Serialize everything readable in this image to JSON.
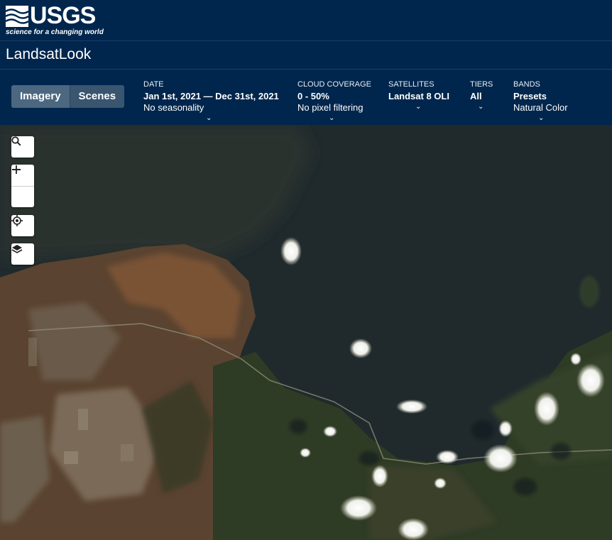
{
  "header": {
    "logo_word": "USGS",
    "logo_tagline": "science for a changing world",
    "app_title": "LandsatLook"
  },
  "view_toggle": {
    "imagery_label": "Imagery",
    "scenes_label": "Scenes",
    "active": "Imagery"
  },
  "filters": {
    "date": {
      "label": "DATE",
      "value": "Jan 1st, 2021 — Dec 31st, 2021",
      "sub": "No seasonality"
    },
    "cloud": {
      "label": "CLOUD COVERAGE",
      "value": "0 - 50%",
      "sub": "No pixel filtering"
    },
    "satellites": {
      "label": "SATELLITES",
      "value": "Landsat 8 OLI"
    },
    "tiers": {
      "label": "TIERS",
      "value": "All"
    },
    "bands": {
      "label": "BANDS",
      "value": "Presets",
      "sub": "Natural Color"
    }
  },
  "map_controls": [
    "search-icon",
    "zoom-in-icon",
    "zoom-out-icon",
    "locate-icon",
    "layers-icon"
  ],
  "colors": {
    "header_bg": "#00264d",
    "toggle_active": "#4c6780",
    "water": "#1e2a2c",
    "forest": "#2a3a24",
    "bare_land": "#6b4a32"
  }
}
